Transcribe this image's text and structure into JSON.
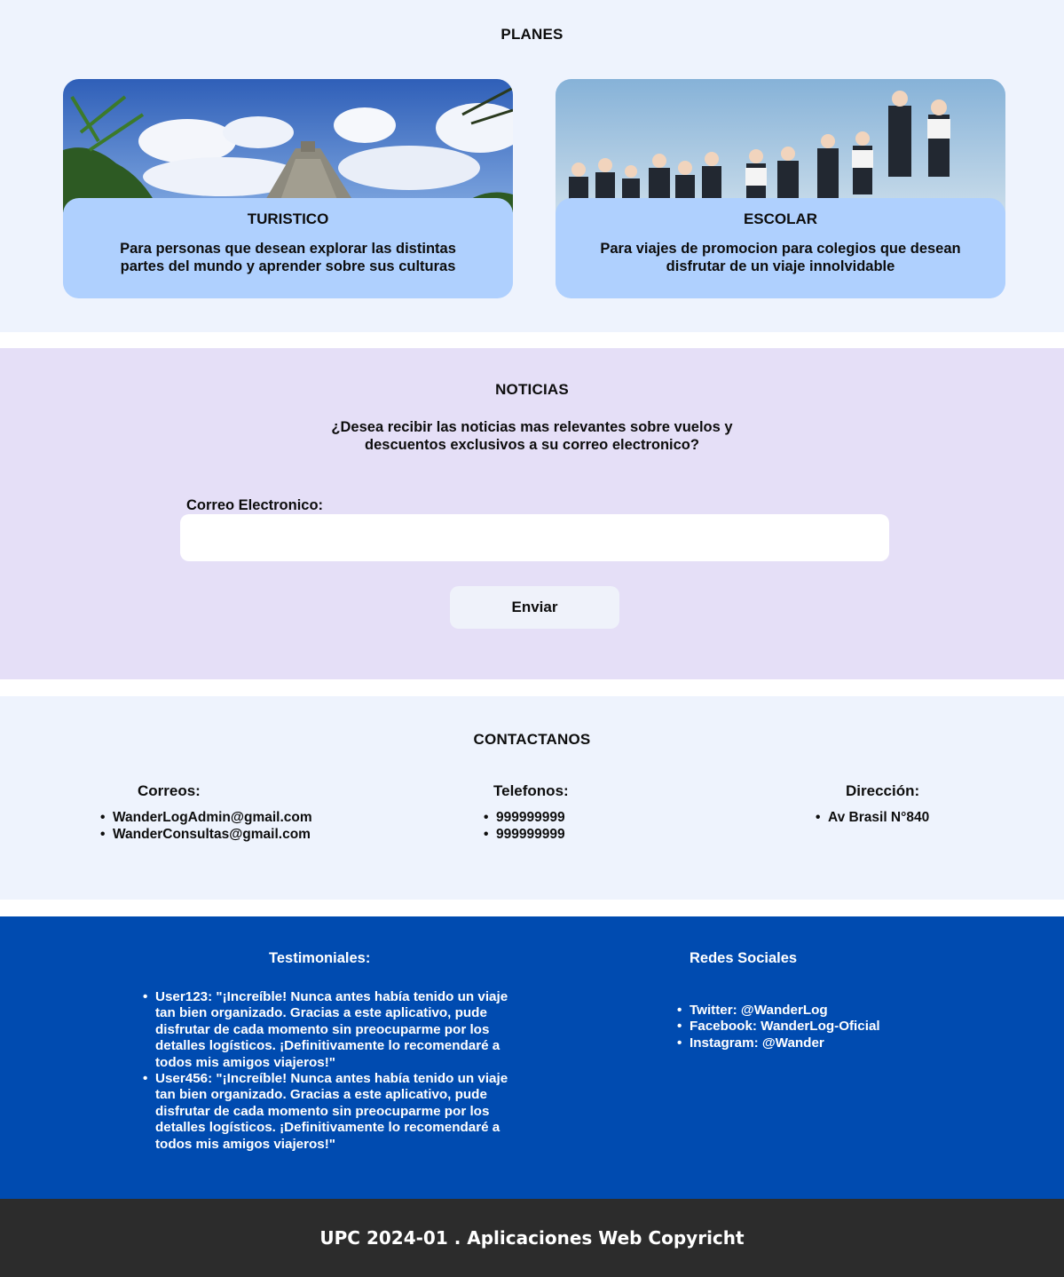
{
  "planes": {
    "title": "PLANES",
    "cards": [
      {
        "title": "TURISTICO",
        "description": "Para personas que desean explorar las distintas partes del mundo y aprender sobre sus culturas"
      },
      {
        "title": "ESCOLAR",
        "description": "Para viajes de promocion para colegios que desean disfrutar de un viaje innolvidable"
      }
    ]
  },
  "noticias": {
    "title": "NOTICIAS",
    "question_line1": "¿Desea recibir las noticias mas relevantes sobre vuelos y",
    "question_line2": "descuentos exclusivos a su correo electronico?",
    "email_label": "Correo Electronico:",
    "email_value": "",
    "send_label": "Enviar"
  },
  "contact": {
    "title": "CONTACTANOS",
    "correos": {
      "title": "Correos:",
      "items": [
        "WanderLogAdmin@gmail.com",
        "WanderConsultas@gmail.com"
      ]
    },
    "telefonos": {
      "title": "Telefonos:",
      "items": [
        "999999999",
        "999999999"
      ]
    },
    "direccion": {
      "title": "Dirección:",
      "items": [
        "Av Brasil N°840"
      ]
    }
  },
  "testimonials": {
    "title": "Testimoniales:",
    "items": [
      {
        "user": "User123:",
        "text": "\"¡Increíble! Nunca antes había tenido un viaje tan bien organizado. Gracias a este aplicativo, pude disfrutar de cada momento sin preocuparme por los detalles logísticos. ¡Definitivamente lo recomendaré a todos mis amigos viajeros!\""
      },
      {
        "user": "User456:",
        "text": "\"¡Increíble! Nunca antes había tenido un viaje tan bien organizado. Gracias a este aplicativo, pude disfrutar de cada momento sin preocuparme por los detalles logísticos. ¡Definitivamente lo recomendaré a todos mis amigos viajeros!\""
      }
    ]
  },
  "social": {
    "title": "Redes Sociales",
    "items": [
      "Twitter: @WanderLog",
      "Facebook: WanderLog-Oficial",
      "Instagram: @Wander"
    ]
  },
  "footer": {
    "copyright": "UPC 2024-01 . Aplicaciones Web Copyricht"
  },
  "colors": {
    "planes_bg": "#eef3fd",
    "card_bg": "#afd0fe",
    "noticias_bg": "#e5dff7",
    "footer_blue": "#004bb0",
    "copyright_bg": "#2c2c2c"
  }
}
